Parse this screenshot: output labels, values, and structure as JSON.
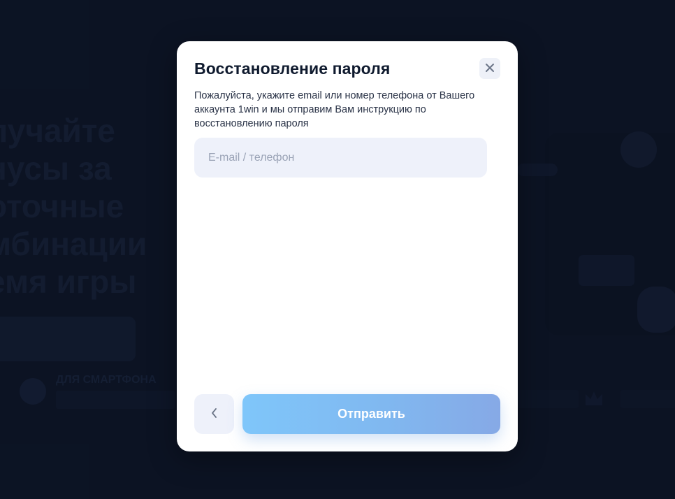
{
  "background": {
    "headline_lines": [
      "лучайте",
      "нусы за",
      "оточные",
      "мбинации",
      "емя игры"
    ],
    "promo_title": "ДЛЯ СМАРТФОНА"
  },
  "modal": {
    "title": "Восстановление пароля",
    "description": "Пожалуйста, укажите email или номер телефона от Вашего аккаунта 1win и мы отправим Вам инструкцию по восстановлению пароля",
    "input_placeholder": "E-mail / телефон",
    "input_value": "",
    "submit_label": "Отправить",
    "close_icon": "close-icon",
    "back_icon": "chevron-left-icon"
  },
  "colors": {
    "page_bg": "#101a2c",
    "modal_bg": "#ffffff",
    "input_bg": "#eef1fa",
    "accent_start": "#7fc6fa",
    "accent_end": "#86a9e6",
    "title_text": "#0f1a2e"
  }
}
